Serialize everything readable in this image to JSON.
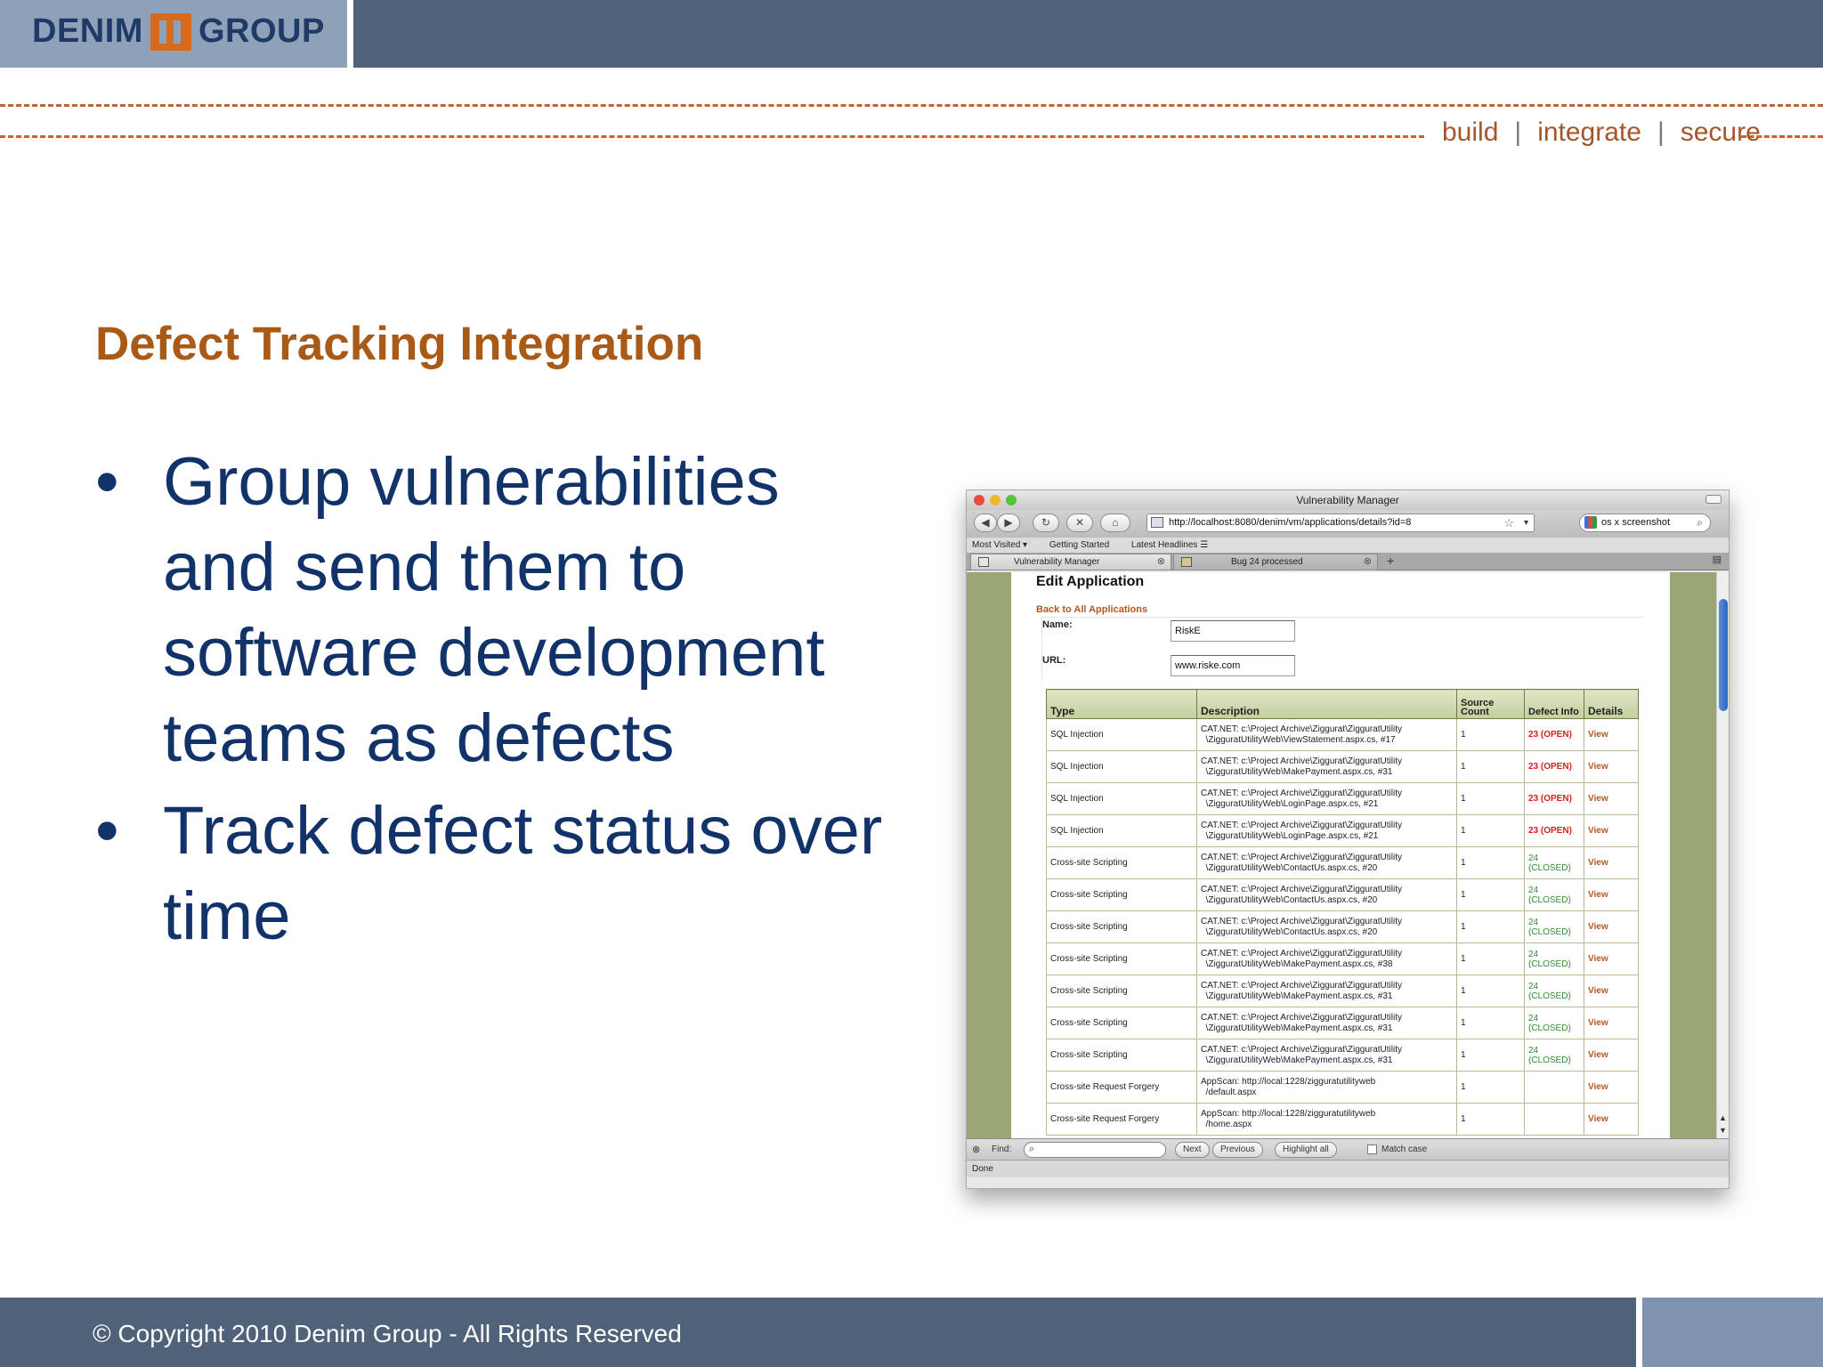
{
  "header": {
    "logo_left": "DENIM",
    "logo_right": "GROUP",
    "tagline": [
      "build",
      "integrate",
      "secure"
    ],
    "tagline_sep": "|"
  },
  "slide": {
    "title": "Defect Tracking Integration",
    "bullet_char": "•",
    "bullets": [
      "Group vulnerabilities and send them to software development teams as defects",
      "Track defect status over time"
    ]
  },
  "footer": {
    "copyright": "© Copyright 2010 Denim Group - All Rights Reserved"
  },
  "browser": {
    "window_title": "Vulnerability Manager",
    "url": "http://localhost:8080/denim/vm/applications/details?id=8",
    "search_value": "os x screenshot",
    "icons": {
      "back": "◀",
      "forward": "▶",
      "reload": "↻",
      "stop": "✕",
      "home": "⌂",
      "star": "☆",
      "dropdown": "▾",
      "search": "⌕",
      "close": "⊗",
      "plus": "+",
      "list": "▤"
    },
    "bookmarks": [
      "Most Visited ▾",
      "Getting Started",
      "Latest Headlines ☰"
    ],
    "tabs": [
      {
        "label": "Vulnerability Manager",
        "active": true
      },
      {
        "label": "Bug 24 processed",
        "active": false
      }
    ],
    "find": {
      "label": "Find:",
      "next": "Next",
      "previous": "Previous",
      "highlight": "Highlight all",
      "match_case": "Match case"
    },
    "status": "Done"
  },
  "app": {
    "page_title": "Edit Application",
    "back_link": "Back to All Applications",
    "name_label": "Name:",
    "name_value": "RiskE",
    "url_label": "URL:",
    "url_value": "www.riske.com",
    "table": {
      "headers": [
        "Type",
        "Description",
        "Source Count",
        "Defect Info",
        "Details"
      ],
      "rows": [
        {
          "type": "SQL Injection",
          "desc": "CAT.NET: c:\\Project Archive\\Ziggurat\\ZigguratUtility\n  \\ZigguratUtilityWeb\\ViewStatement.aspx.cs, #17",
          "count": "1",
          "defect": "23 (OPEN)",
          "open": true,
          "details": "View"
        },
        {
          "type": "SQL Injection",
          "desc": "CAT.NET: c:\\Project Archive\\Ziggurat\\ZigguratUtility\n  \\ZigguratUtilityWeb\\MakePayment.aspx.cs, #31",
          "count": "1",
          "defect": "23 (OPEN)",
          "open": true,
          "details": "View"
        },
        {
          "type": "SQL Injection",
          "desc": "CAT.NET: c:\\Project Archive\\Ziggurat\\ZigguratUtility\n  \\ZigguratUtilityWeb\\LoginPage.aspx.cs, #21",
          "count": "1",
          "defect": "23 (OPEN)",
          "open": true,
          "details": "View"
        },
        {
          "type": "SQL Injection",
          "desc": "CAT.NET: c:\\Project Archive\\Ziggurat\\ZigguratUtility\n  \\ZigguratUtilityWeb\\LoginPage.aspx.cs, #21",
          "count": "1",
          "defect": "23 (OPEN)",
          "open": true,
          "details": "View"
        },
        {
          "type": "Cross-site Scripting",
          "desc": "CAT.NET: c:\\Project Archive\\Ziggurat\\ZigguratUtility\n  \\ZigguratUtilityWeb\\ContactUs.aspx.cs, #20",
          "count": "1",
          "defect": "24\n(CLOSED)",
          "open": false,
          "details": "View"
        },
        {
          "type": "Cross-site Scripting",
          "desc": "CAT.NET: c:\\Project Archive\\Ziggurat\\ZigguratUtility\n  \\ZigguratUtilityWeb\\ContactUs.aspx.cs, #20",
          "count": "1",
          "defect": "24\n(CLOSED)",
          "open": false,
          "details": "View"
        },
        {
          "type": "Cross-site Scripting",
          "desc": "CAT.NET: c:\\Project Archive\\Ziggurat\\ZigguratUtility\n  \\ZigguratUtilityWeb\\ContactUs.aspx.cs, #20",
          "count": "1",
          "defect": "24\n(CLOSED)",
          "open": false,
          "details": "View"
        },
        {
          "type": "Cross-site Scripting",
          "desc": "CAT.NET: c:\\Project Archive\\Ziggurat\\ZigguratUtility\n  \\ZigguratUtilityWeb\\MakePayment.aspx.cs, #38",
          "count": "1",
          "defect": "24\n(CLOSED)",
          "open": false,
          "details": "View"
        },
        {
          "type": "Cross-site Scripting",
          "desc": "CAT.NET: c:\\Project Archive\\Ziggurat\\ZigguratUtility\n  \\ZigguratUtilityWeb\\MakePayment.aspx.cs, #31",
          "count": "1",
          "defect": "24\n(CLOSED)",
          "open": false,
          "details": "View"
        },
        {
          "type": "Cross-site Scripting",
          "desc": "CAT.NET: c:\\Project Archive\\Ziggurat\\ZigguratUtility\n  \\ZigguratUtilityWeb\\MakePayment.aspx.cs, #31",
          "count": "1",
          "defect": "24\n(CLOSED)",
          "open": false,
          "details": "View"
        },
        {
          "type": "Cross-site Scripting",
          "desc": "CAT.NET: c:\\Project Archive\\Ziggurat\\ZigguratUtility\n  \\ZigguratUtilityWeb\\MakePayment.aspx.cs, #31",
          "count": "1",
          "defect": "24\n(CLOSED)",
          "open": false,
          "details": "View"
        },
        {
          "type": "Cross-site Request Forgery",
          "desc": "AppScan: http://local:1228/zigguratutilityweb\n  /default.aspx",
          "count": "1",
          "defect": "",
          "open": false,
          "details": "View"
        },
        {
          "type": "Cross-site Request Forgery",
          "desc": "AppScan: http://local:1228/zigguratutilityweb\n  /home.aspx",
          "count": "1",
          "defect": "",
          "open": false,
          "details": "View"
        }
      ]
    }
  }
}
